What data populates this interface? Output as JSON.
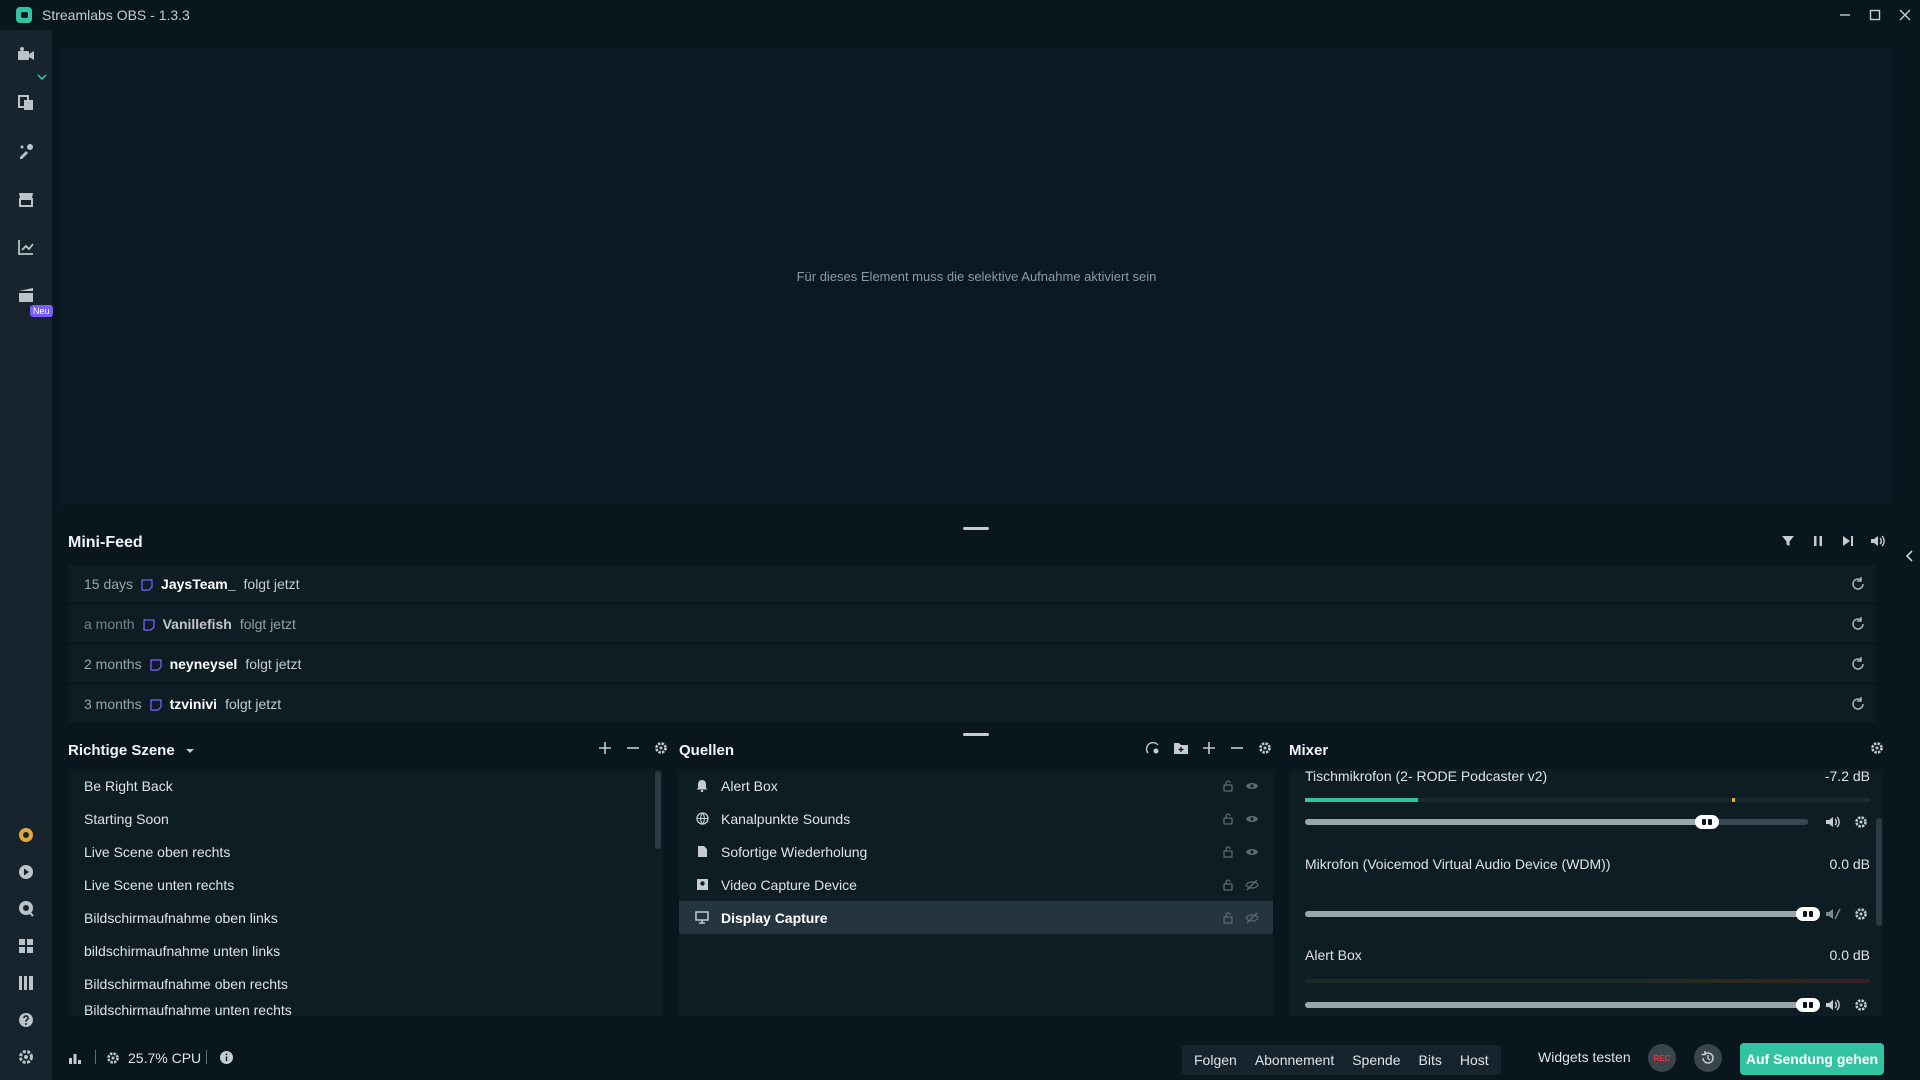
{
  "window": {
    "title": "Streamlabs OBS - 1.3.3",
    "controls": [
      "minimize",
      "maximize",
      "close"
    ]
  },
  "sidebar": {
    "items": [
      {
        "icon": "video-camera-icon"
      },
      {
        "icon": "layout-editor-icon"
      },
      {
        "icon": "themes-icon"
      },
      {
        "icon": "store-icon"
      },
      {
        "icon": "dashboard-chart-icon"
      },
      {
        "icon": "studio-mode-icon",
        "badge": "Neu"
      }
    ],
    "bottom_items": [
      {
        "icon": "prime-icon"
      },
      {
        "icon": "play-circle-icon"
      },
      {
        "icon": "chat-bubble-icon"
      },
      {
        "icon": "grid-apps-icon"
      },
      {
        "icon": "library-icon"
      },
      {
        "icon": "help-icon"
      },
      {
        "icon": "settings-gear-icon"
      }
    ]
  },
  "preview": {
    "message": "Für dieses Element muss die selektive Aufnahme aktiviert sein"
  },
  "mini_feed": {
    "title": "Mini-Feed",
    "events": [
      {
        "time": "15 days",
        "user": "JaysTeam_",
        "action": "folgt jetzt"
      },
      {
        "time": "a month",
        "user": "Vanillefish",
        "action": "folgt jetzt"
      },
      {
        "time": "2 months",
        "user": "neyneysel",
        "action": "folgt jetzt"
      },
      {
        "time": "3 months",
        "user": "tzvinivi",
        "action": "folgt jetzt"
      }
    ]
  },
  "scenes": {
    "title": "Richtige Szene",
    "items": [
      "Be Right Back",
      "Starting Soon",
      "Live Scene oben rechts",
      "Live Scene unten rechts",
      "Bildschirmaufnahme oben links",
      "bildschirmaufnahme unten links",
      "Bildschirmaufnahme oben rechts",
      "Bildschirmaufnahme unten rechts"
    ]
  },
  "sources": {
    "title": "Quellen",
    "items": [
      {
        "name": "Alert Box",
        "icon": "bell-icon",
        "selected": false
      },
      {
        "name": "Kanalpunkte Sounds",
        "icon": "globe-icon",
        "selected": false
      },
      {
        "name": "Sofortige Wiederholung",
        "icon": "file-icon",
        "selected": false
      },
      {
        "name": "Video Capture Device",
        "icon": "webcam-icon",
        "selected": false
      },
      {
        "name": "Display Capture",
        "icon": "monitor-icon",
        "selected": true
      }
    ]
  },
  "mixer": {
    "title": "Mixer",
    "channels": [
      {
        "name": "Tischmikrofon (2- RODE Podcaster v2)",
        "db": "-7.2 dB",
        "level": 0.2,
        "volume": 0.8,
        "muted": false
      },
      {
        "name": "Mikrofon (Voicemod Virtual Audio Device (WDM))",
        "db": "0.0 dB",
        "level": 0.0,
        "volume": 1.0,
        "muted": true
      },
      {
        "name": "Alert Box",
        "db": "0.0 dB",
        "level": 0.0,
        "volume": 1.0,
        "muted": false
      }
    ]
  },
  "footer": {
    "cpu": "25.7% CPU",
    "test_buttons": [
      "Folgen",
      "Abonnement",
      "Spende",
      "Bits",
      "Host"
    ],
    "widgets_label": "Widgets testen",
    "rec_label": "REC",
    "go_live": "Auf Sendung gehen"
  },
  "colors": {
    "accent": "#31c3a2",
    "twitch": "#7b5cff",
    "rec": "#e0394a"
  }
}
